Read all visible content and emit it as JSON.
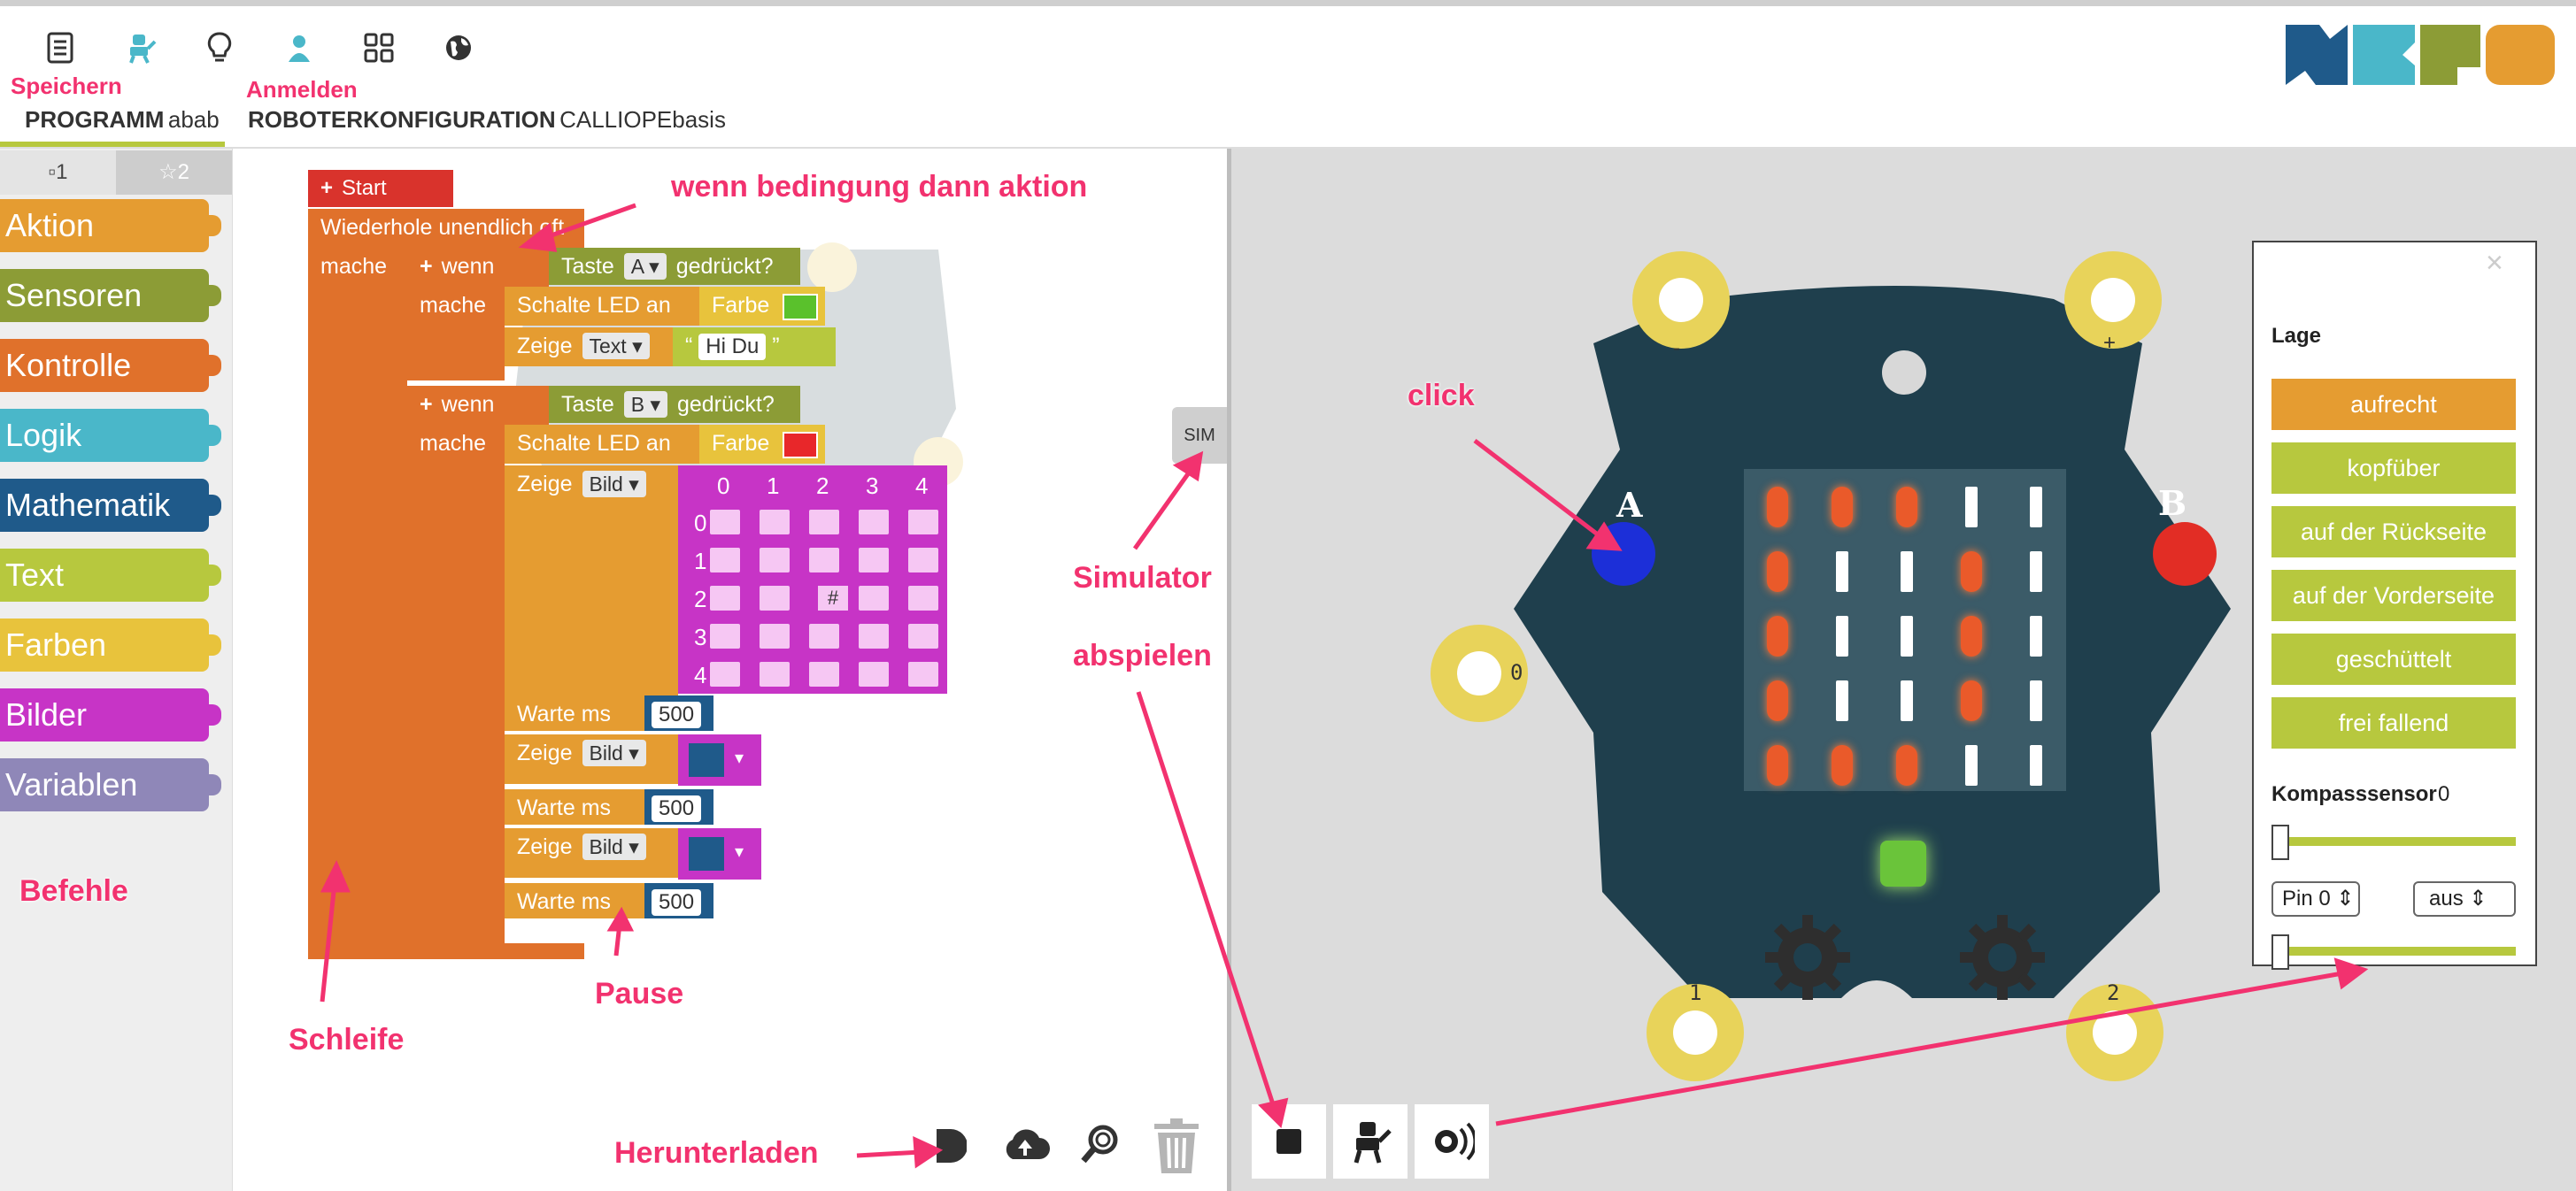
{
  "header": {
    "program_label": "PROGRAMM",
    "program_name": "abab",
    "robot_label": "ROBOTERKONFIGURATION",
    "robot_name": "CALLIOPEbasis",
    "icons": [
      "document-icon",
      "robot-icon",
      "lightbulb-icon",
      "user-icon",
      "grid-icon",
      "globe-icon"
    ]
  },
  "annotations": {
    "speichern": "Speichern",
    "anmelden": "Anmelden",
    "wenn_dann": "wenn bedingung dann aktion",
    "click": "click",
    "simulator": "Simulator",
    "abspielen": "abspielen",
    "befehle": "Befehle",
    "schleife": "Schleife",
    "pause": "Pause",
    "herunterladen": "Herunterladen"
  },
  "toolbox": {
    "tab1": "▫1",
    "tab2": "☆2",
    "categories": [
      {
        "label": "Aktion",
        "color": "#e59c31"
      },
      {
        "label": "Sensoren",
        "color": "#8c9c36"
      },
      {
        "label": "Kontrolle",
        "color": "#e0712b"
      },
      {
        "label": "Logik",
        "color": "#4ab7c9"
      },
      {
        "label": "Mathematik",
        "color": "#1f5a8a"
      },
      {
        "label": "Text",
        "color": "#b7c83e"
      },
      {
        "label": "Farben",
        "color": "#e8c33c"
      },
      {
        "label": "Bilder",
        "color": "#c734c6"
      },
      {
        "label": "Variablen",
        "color": "#8f87b8"
      }
    ]
  },
  "program": {
    "start": "Start",
    "repeat": "Wiederhole unendlich oft",
    "mache": "mache",
    "wenn": "wenn",
    "taste": "Taste",
    "taste_a": "A",
    "taste_b": "B",
    "gedrueckt": "gedrückt?",
    "schalte_led": "Schalte LED an",
    "farbe": "Farbe",
    "zeige": "Zeige",
    "text_opt": "Text",
    "bild_opt": "Bild",
    "hi_du": "Hi Du",
    "quote_open": "“",
    "quote_close": "”",
    "warte": "Warte ms",
    "ms_value": "500",
    "grid_cols": [
      "0",
      "1",
      "2",
      "3",
      "4"
    ],
    "grid_rows": [
      "0",
      "1",
      "2",
      "3",
      "4"
    ],
    "grid_hash": "#",
    "led_green": "#5ac12c",
    "led_red": "#e8272a"
  },
  "sim_tab": "SIM",
  "board": {
    "pin_minus": "-",
    "pin_plus": "+",
    "pin_0": "0",
    "pin_1": "1",
    "pin_2": "2",
    "button_a": "A",
    "button_b": "B",
    "matrix": [
      [
        1,
        1,
        1,
        0,
        0
      ],
      [
        1,
        0,
        0,
        1,
        0
      ],
      [
        1,
        0,
        0,
        1,
        0
      ],
      [
        1,
        0,
        0,
        1,
        0
      ],
      [
        1,
        1,
        1,
        0,
        0
      ]
    ]
  },
  "panel": {
    "close": "×",
    "lage_title": "Lage",
    "positions": [
      "aufrecht",
      "kopfüber",
      "auf der Rückseite",
      "auf der Vorderseite",
      "geschüttelt",
      "frei fallend"
    ],
    "compass_label": "Kompasssensor",
    "compass_value": "0",
    "pin_select": "Pin 0",
    "state_select": "aus"
  },
  "toolbar_icons": [
    "play-icon",
    "cloud-upload-icon",
    "zoom-icon",
    "trash-icon"
  ],
  "sim_controls": [
    "stop-icon",
    "robot-icon",
    "sound-icon"
  ]
}
